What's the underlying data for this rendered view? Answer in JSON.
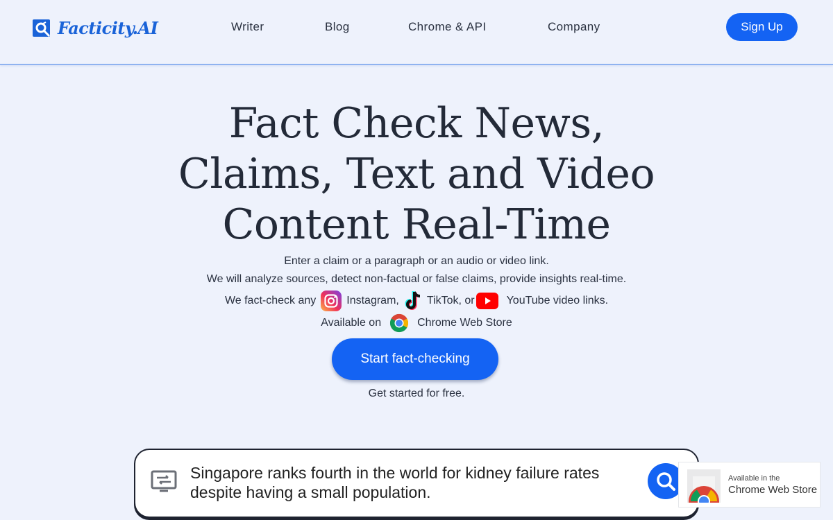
{
  "brand": {
    "name": "Facticity.AI"
  },
  "nav": {
    "links": [
      "Writer",
      "Blog",
      "Chrome & API",
      "Company"
    ],
    "signup_label": "Sign Up"
  },
  "hero": {
    "title_lines": [
      "Fact Check News,",
      "Claims, Text and Video",
      "Content Real-Time"
    ],
    "line1": "Enter a claim or a paragraph or an audio or video link.",
    "line2": "We will analyze sources, detect non-factual or false claims, provide insights real-time.",
    "platforms": {
      "prefix": "We fact-check any",
      "instagram": "Instagram,",
      "tiktok": "TikTok, or",
      "youtube": "YouTube video links."
    },
    "available": {
      "prefix": "Available on",
      "store": "Chrome Web Store"
    },
    "cta_label": "Start fact-checking",
    "cta_sub": "Get started for free."
  },
  "search": {
    "value": "Singapore ranks fourth in the world for kidney failure rates despite having a small population."
  },
  "chrome_badge": {
    "small": "Available in the",
    "big": "Chrome Web Store"
  },
  "colors": {
    "accent": "#1463f3",
    "background": "#eef2fc",
    "logo": "#1a63d8"
  }
}
